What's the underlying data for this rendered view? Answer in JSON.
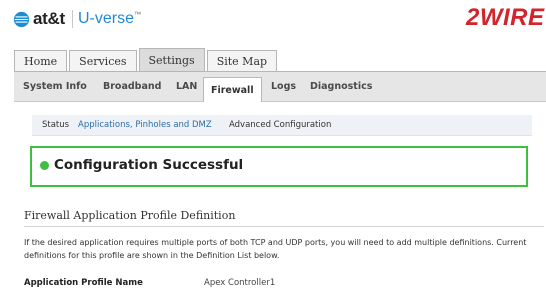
{
  "branding": {
    "att_label": "at&t",
    "product_label": "U-verse",
    "product_mark": "™",
    "vendor_logo": "2WIRE",
    "colors": {
      "att_blue": "#1f8bd0",
      "vendor_red": "#d3232b"
    }
  },
  "main_tabs": [
    {
      "label": "Home",
      "active": false
    },
    {
      "label": "Services",
      "active": false
    },
    {
      "label": "Settings",
      "active": true
    },
    {
      "label": "Site Map",
      "active": false
    }
  ],
  "sub_tabs": [
    {
      "label": "System Info",
      "active": false
    },
    {
      "label": "Broadband",
      "active": false
    },
    {
      "label": "LAN",
      "active": false
    },
    {
      "label": "Firewall",
      "active": true
    },
    {
      "label": "Logs",
      "active": false
    },
    {
      "label": "Diagnostics",
      "active": false
    }
  ],
  "firewall_nav": [
    {
      "label": "Status",
      "active": false
    },
    {
      "label": "Applications, Pinholes and DMZ",
      "active": true
    },
    {
      "label": "Advanced Configuration",
      "active": false
    }
  ],
  "alert": {
    "message": "Configuration Successful",
    "icon": "success-dot-icon",
    "color": "#3fbf3f"
  },
  "section": {
    "title": "Firewall Application Profile Definition",
    "description": "If the desired application requires multiple ports of both TCP and UDP ports, you will need to add multiple definitions. Current definitions for this profile are shown in the Definition List below."
  },
  "form": {
    "profile_name_label": "Application Profile Name",
    "profile_name_value": "Apex Controller1"
  }
}
